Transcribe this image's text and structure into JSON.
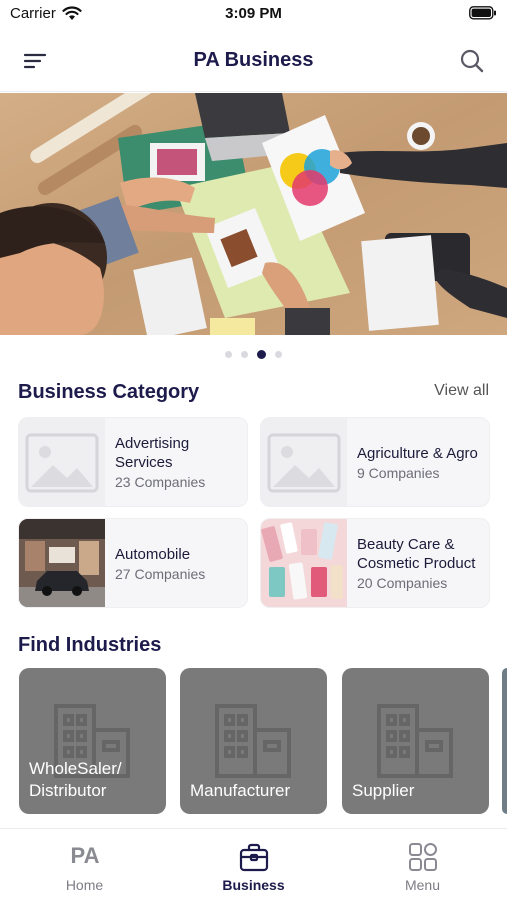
{
  "status": {
    "carrier": "Carrier",
    "time": "3:09 PM"
  },
  "header": {
    "title": "PA Business"
  },
  "banner": {
    "slide_count": 4,
    "active_slide": 3
  },
  "categories": {
    "title": "Business Category",
    "view_all": "View all",
    "items": [
      {
        "name": "Advertising Services",
        "count": "23 Companies",
        "image": "placeholder"
      },
      {
        "name": "Agriculture & Agro",
        "count": "9 Companies",
        "image": "placeholder"
      },
      {
        "name": "Automobile",
        "count": "27 Companies",
        "image": "garage-photo"
      },
      {
        "name": "Beauty Care & Cosmetic Product",
        "count": "20 Companies",
        "image": "cosmetics-photo"
      }
    ]
  },
  "industries": {
    "title": "Find Industries",
    "items": [
      {
        "label": "WholeSaler/ Distributor",
        "icon": "building-icon"
      },
      {
        "label": "Manufacturer",
        "icon": "building-icon"
      },
      {
        "label": "Supplier",
        "icon": "building-icon"
      }
    ]
  },
  "tabs": [
    {
      "label": "Home",
      "logo": "PA",
      "icon": "pa-logo-icon"
    },
    {
      "label": "Business",
      "icon": "briefcase-icon",
      "active": true
    },
    {
      "label": "Menu",
      "icon": "grid-icon"
    }
  ],
  "colors": {
    "brand": "#1d1b4b",
    "tile": "#7a7a7a",
    "card": "#f6f6f8"
  }
}
